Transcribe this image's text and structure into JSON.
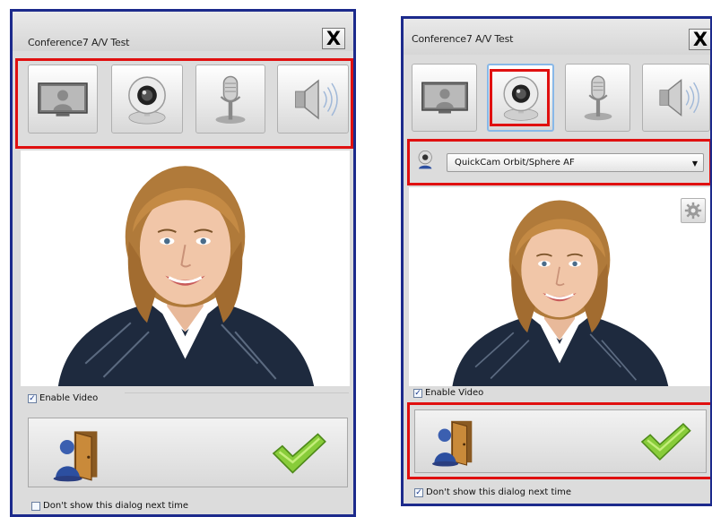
{
  "dialog_left": {
    "title": "Conference7 A/V Test",
    "close_label": "X",
    "tabs": [
      {
        "icon": "monitor-person-icon"
      },
      {
        "icon": "webcam-icon"
      },
      {
        "icon": "microphone-icon"
      },
      {
        "icon": "speaker-icon"
      }
    ],
    "enable_video_label": "Enable Video",
    "enable_video_checked": true,
    "dont_show_label": "Don't show this dialog next time",
    "dont_show_checked": false
  },
  "dialog_right": {
    "title": "Conference7 A/V Test",
    "close_label": "X",
    "selected_tab": "webcam",
    "camera_select_value": "QuickCam Orbit/Sphere AF",
    "enable_video_label": "Enable Video",
    "enable_video_checked": true,
    "dont_show_label": "Don't show this dialog next time",
    "dont_show_checked": true
  },
  "colors": {
    "highlight": "#e01010",
    "window_border": "#1c2a8c",
    "confirm_green": "#7cc63a"
  }
}
